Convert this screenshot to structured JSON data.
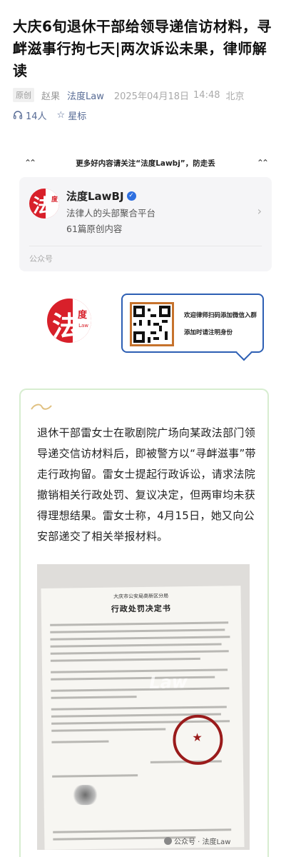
{
  "article": {
    "title": "大庆6旬退休干部给领导递信访材料，寻衅滋事行拘七天|两次诉讼未果，律师解读",
    "badge": "原创",
    "author": "赵果",
    "account": "法度Law",
    "date": "2025年04月18日",
    "time": "14:48",
    "location": "北京",
    "listeners": "14人",
    "star_label": "星标",
    "listen_icon": "headphones-icon",
    "star_icon": "star-icon"
  },
  "promo_banner": {
    "text": "更多好内容请关注“法度Lawbj”，防走丢",
    "left_icon": "double-chevron-up-icon",
    "right_icon": "double-chevron-up-icon"
  },
  "account_card": {
    "name": "法度LawBJ",
    "description": "法律人的头部聚合平台",
    "article_count": "61篇原创内容",
    "footer": "公众号",
    "logo_glyph": "法",
    "logo_small": "度"
  },
  "qr_promo": {
    "line1": "欢迎律师扫码添加微信入群",
    "line2": "添加时请注明身份",
    "border_color": "#2d5fb4"
  },
  "big_logo": {
    "glyph": "法",
    "small": "度",
    "law": "Law"
  },
  "body_text": "退休干部雷女士在歌剧院广场向某政法部门领导递交信访材料后，即被警方以“寻衅滋事”带走行政拘留。雷女士提起行政诉讼，请求法院撤销相关行政处罚、复议决定，但两审均未获得理想结果。雷女士称，4月15日，她又向公安部递交了相关举报材料。",
  "document_photo": {
    "org": "大庆市公安局高新区分局",
    "title": "行政处罚决定书"
  },
  "source_tag": "公众号 · 法度Law",
  "colors": {
    "accent_link": "#576b95",
    "brand_red": "#d8202a",
    "frame_green": "#d7edd0"
  }
}
